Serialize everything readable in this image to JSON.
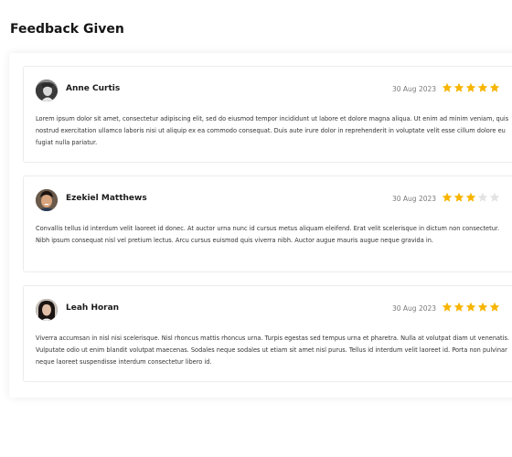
{
  "page": {
    "title": "Feedback Given"
  },
  "colors": {
    "star_filled": "#f7b500",
    "star_empty": "#e3e3e3",
    "text": "#333333",
    "muted": "#7a7a7a"
  },
  "reviews": [
    {
      "name": "Anne Curtis",
      "date": "30 Aug 2023",
      "rating": 5,
      "max_rating": 5,
      "avatar_icon": "avatar-woman-grayscale",
      "text": "Lorem ipsum dolor sit amet, consectetur adipiscing elit, sed do eiusmod tempor incididunt ut labore et dolore magna aliqua. Ut enim ad minim veniam, quis nostrud exercitation ullamco laboris nisi ut aliquip ex ea commodo consequat. Duis aute irure dolor in reprehenderit in voluptate velit esse cillum dolore eu fugiat nulla pariatur."
    },
    {
      "name": "Ezekiel Matthews",
      "date": "30 Aug 2023",
      "rating": 3,
      "max_rating": 5,
      "avatar_icon": "avatar-man-smiling",
      "text": "Convallis tellus id interdum velit laoreet id donec. At auctor urna nunc id cursus metus aliquam eleifend. Erat velit scelerisque in dictum non consectetur. Nibh ipsum consequat nisl vel pretium lectus. Arcu cursus euismod quis viverra nibh. Auctor augue mauris augue neque gravida in."
    },
    {
      "name": "Leah Horan",
      "date": "30 Aug 2023",
      "rating": 5,
      "max_rating": 5,
      "avatar_icon": "avatar-woman-dark-hair",
      "text": "Viverra accumsan in nisl nisi scelerisque. Nisl rhoncus mattis rhoncus urna. Turpis egestas sed tempus urna et pharetra. Nulla at volutpat diam ut venenatis. Vulputate odio ut enim blandit volutpat maecenas. Sodales neque sodales ut etiam sit amet nisl purus. Tellus id interdum velit laoreet id. Porta non pulvinar neque laoreet suspendisse interdum consectetur libero id."
    }
  ]
}
